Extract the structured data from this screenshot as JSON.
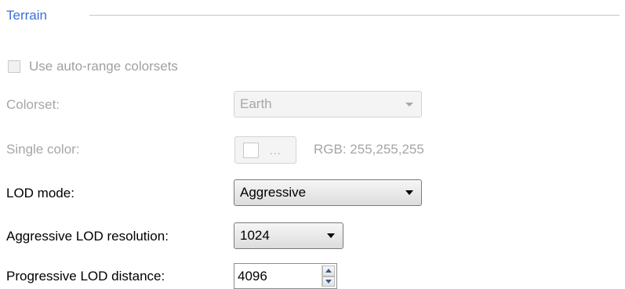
{
  "group": {
    "title": "Terrain"
  },
  "auto_range": {
    "label": "Use auto-range colorsets",
    "checked": false,
    "enabled": false
  },
  "colorset": {
    "label": "Colorset:",
    "value": "Earth",
    "enabled": false
  },
  "single_color": {
    "label": "Single color:",
    "button_text": "...",
    "rgb_text": "RGB: 255,255,255",
    "swatch_color": "#ffffff",
    "enabled": false
  },
  "lod_mode": {
    "label": "LOD mode:",
    "value": "Aggressive"
  },
  "aggressive_lod": {
    "label": "Aggressive LOD resolution:",
    "value": "1024"
  },
  "progressive_lod": {
    "label": "Progressive LOD distance:",
    "value": "4096"
  },
  "colors": {
    "group_title": "#3a6fd8",
    "disabled_text": "#a6a6a6"
  }
}
